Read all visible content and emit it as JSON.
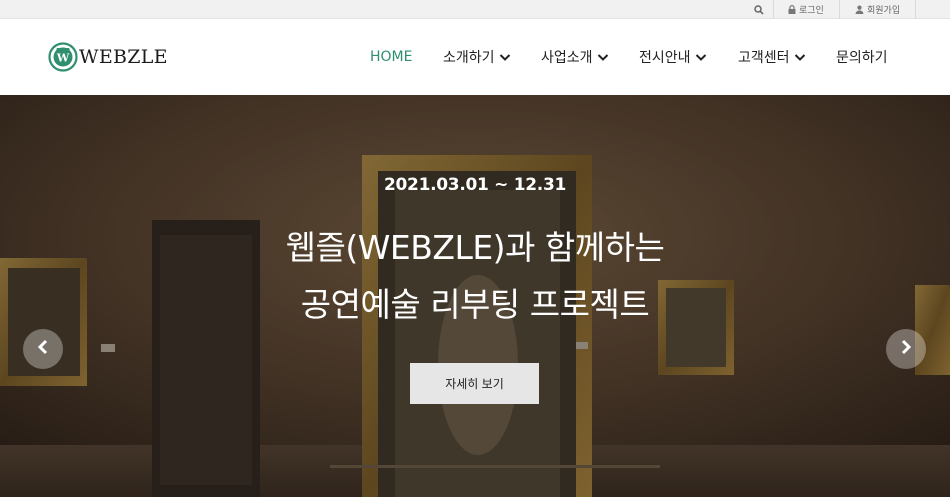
{
  "topbar": {
    "search_icon": "search-icon",
    "login_label": "로그인",
    "join_label": "회원가입"
  },
  "logo": {
    "text": "WEBZLE",
    "mark_letter": "W",
    "brand_color": "#2f8f6f"
  },
  "nav": {
    "items": [
      {
        "label": "HOME",
        "active": true,
        "dropdown": false
      },
      {
        "label": "소개하기",
        "active": false,
        "dropdown": true
      },
      {
        "label": "사업소개",
        "active": false,
        "dropdown": true
      },
      {
        "label": "전시안내",
        "active": false,
        "dropdown": true
      },
      {
        "label": "고객센터",
        "active": false,
        "dropdown": true
      },
      {
        "label": "문의하기",
        "active": false,
        "dropdown": false
      }
    ]
  },
  "hero": {
    "date": "2021.03.01 ~ 12.31",
    "title_line1": "웹즐(WEBZLE)과 함께하는",
    "title_line2": "공연예술 리부팅 프로젝트",
    "button_label": "자세히 보기",
    "prev_icon": "chevron-left-icon",
    "next_icon": "chevron-right-icon"
  }
}
